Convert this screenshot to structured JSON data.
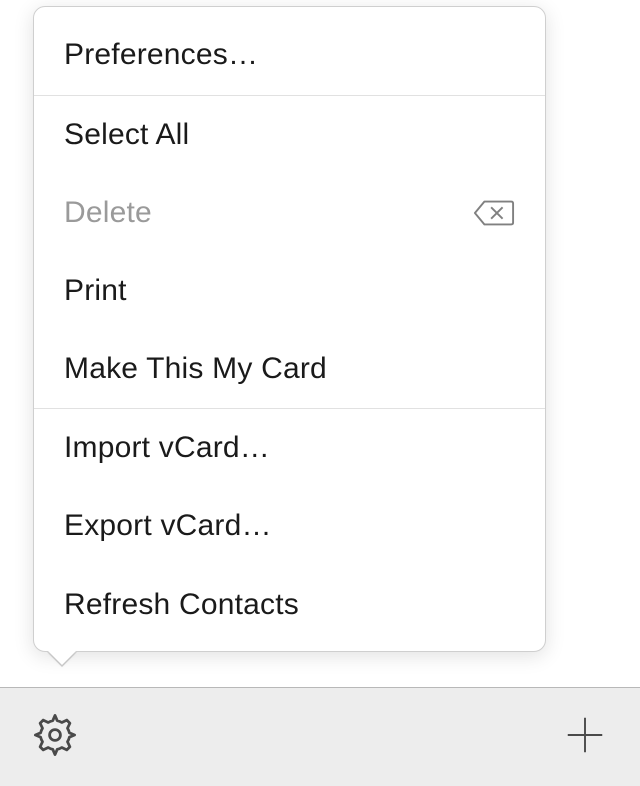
{
  "menu": {
    "preferences": "Preferences…",
    "select_all": "Select All",
    "delete": "Delete",
    "print": "Print",
    "make_my_card": "Make This My Card",
    "import_vcard": "Import vCard…",
    "export_vcard": "Export vCard…",
    "refresh_contacts": "Refresh Contacts"
  }
}
